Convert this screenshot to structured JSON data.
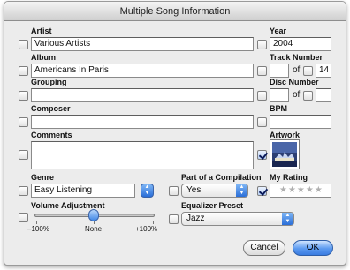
{
  "window": {
    "title": "Multiple Song Information"
  },
  "artist": {
    "label": "Artist",
    "value": "Various Artists"
  },
  "year": {
    "label": "Year",
    "value": "2004"
  },
  "album": {
    "label": "Album",
    "value": "Americans In Paris"
  },
  "track": {
    "label": "Track Number",
    "value": "",
    "of_label": "of",
    "total": "14"
  },
  "grouping": {
    "label": "Grouping",
    "value": ""
  },
  "disc": {
    "label": "Disc Number",
    "value": "",
    "of_label": "of",
    "total": ""
  },
  "composer": {
    "label": "Composer",
    "value": ""
  },
  "bpm": {
    "label": "BPM",
    "value": ""
  },
  "comments": {
    "label": "Comments",
    "value": ""
  },
  "artwork": {
    "label": "Artwork",
    "checked": true
  },
  "genre": {
    "label": "Genre",
    "value": "Easy Listening"
  },
  "compilation": {
    "label": "Part of a Compilation",
    "value": "Yes"
  },
  "rating": {
    "label": "My Rating",
    "stars": "★★★★★",
    "checked": true,
    "value": 0
  },
  "volume": {
    "label": "Volume Adjustment",
    "min_label": "–100%",
    "mid_label": "None",
    "max_label": "+100%",
    "value": 0
  },
  "equalizer": {
    "label": "Equalizer Preset",
    "value": "Jazz"
  },
  "buttons": {
    "cancel": "Cancel",
    "ok": "OK"
  }
}
